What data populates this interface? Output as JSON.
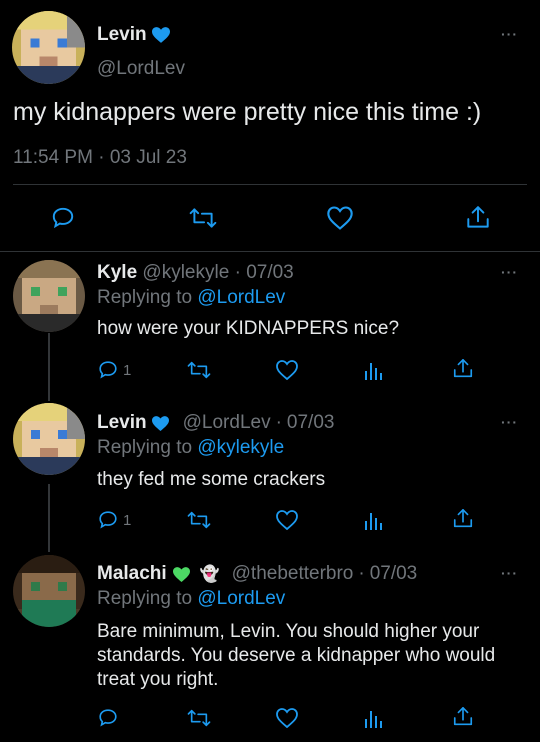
{
  "main_tweet": {
    "name": "Levin",
    "badge_color": "#1d9bf0",
    "handle": "@LordLev",
    "text": "my kidnappers were pretty nice this time :)",
    "time": "11:54 PM",
    "date": "03 Jul 23",
    "separator": "·",
    "actions": [
      "reply-icon",
      "retweet-icon",
      "like-icon",
      "share-icon"
    ]
  },
  "replies": [
    {
      "name": "Kyle",
      "handle": "@kylekyle",
      "date": "07/03",
      "replying_to_label": "Replying to",
      "replying_to": "@LordLev",
      "text": "how were your KIDNAPPERS nice?",
      "reply_count": "1"
    },
    {
      "name": "Levin",
      "badge_color": "#1d9bf0",
      "handle": "@LordLev",
      "date": "07/03",
      "replying_to_label": "Replying to",
      "replying_to": "@kylekyle",
      "text": "they fed me some crackers",
      "reply_count": "1"
    },
    {
      "name": "Malachi",
      "badge_color": "#4cd964",
      "emoji": "👻",
      "handle": "@thebetterbro",
      "date": "07/03",
      "replying_to_label": "Replying to",
      "replying_to": "@LordLev",
      "text": "Bare minimum, Levin. You should higher your standards. You deserve a kidnapper who would treat you right.",
      "reply_count": ""
    }
  ],
  "more_label": "···",
  "colors": {
    "background": "#000000",
    "text": "#e7e9ea",
    "muted": "#71767b",
    "link": "#1d9bf0",
    "divider": "#2f3336"
  }
}
